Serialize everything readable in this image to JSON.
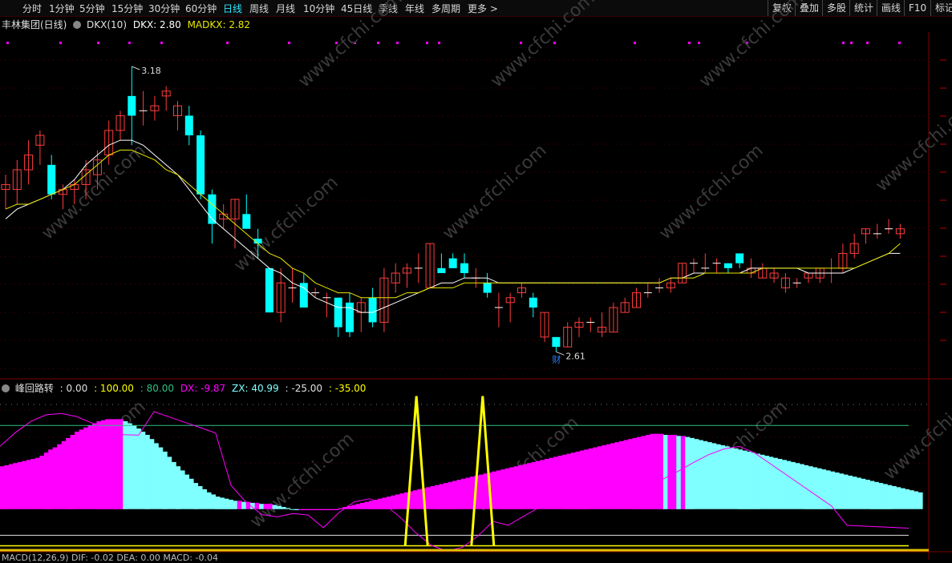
{
  "toolbar": {
    "tabs": [
      "分时",
      "1分钟",
      "5分钟",
      "15分钟",
      "30分钟",
      "60分钟",
      "日线",
      "周线",
      "月线",
      "10分钟",
      "45日线",
      "季线",
      "年线",
      "多周期",
      "更多 >"
    ],
    "active_tab": "日线",
    "right_tabs": [
      "复权",
      "叠加",
      "多股",
      "统计",
      "画线",
      "F10",
      "标记"
    ]
  },
  "main_legend": {
    "stock": "丰林集团(日线)",
    "indicator": "DKX(10)",
    "dkx": "DKX: 2.80",
    "madkx": "MADKX: 2.82"
  },
  "sub_legend": {
    "name": "峰回路转",
    "values": [
      ": 0.00",
      ": 100.00",
      ": 80.00",
      "DX: -9.87",
      "ZX: 40.99",
      ": -25.00",
      ": -35.00"
    ]
  },
  "macd_legend": {
    "text": "MACD(12,26,9)  DIF: -0.02  DEA: 0.00  MACD: -0.04"
  },
  "annotations": {
    "high": "3.18",
    "low": "2.61",
    "marker": "财"
  },
  "watermark": "www.cfchi.com",
  "colors": {
    "up": "#ff3c3c",
    "down": "#00ffff",
    "dkx": "#ffffff",
    "madkx": "#e8e800",
    "magenta": "#ff00ff",
    "cyan_bar": "#7fffff",
    "yellow": "#ffff00",
    "green_line": "#2fbf7f"
  },
  "chart_data": [
    {
      "type": "candlestick",
      "title": "丰林集团(日线)",
      "ylim": [
        2.55,
        3.25
      ],
      "candles": [
        {
          "o": 2.93,
          "h": 2.96,
          "l": 2.89,
          "c": 2.94
        },
        {
          "o": 2.93,
          "h": 2.99,
          "l": 2.9,
          "c": 2.97
        },
        {
          "o": 2.97,
          "h": 3.03,
          "l": 2.94,
          "c": 3.0
        },
        {
          "o": 3.02,
          "h": 3.05,
          "l": 2.98,
          "c": 3.04
        },
        {
          "o": 2.98,
          "h": 3.0,
          "l": 2.91,
          "c": 2.92
        },
        {
          "o": 2.92,
          "h": 2.94,
          "l": 2.89,
          "c": 2.93
        },
        {
          "o": 2.93,
          "h": 2.95,
          "l": 2.9,
          "c": 2.94
        },
        {
          "o": 2.94,
          "h": 2.99,
          "l": 2.91,
          "c": 2.97
        },
        {
          "o": 2.96,
          "h": 3.01,
          "l": 2.93,
          "c": 2.99
        },
        {
          "o": 3.0,
          "h": 3.07,
          "l": 2.98,
          "c": 3.05
        },
        {
          "o": 3.05,
          "h": 3.09,
          "l": 3.03,
          "c": 3.08
        },
        {
          "o": 3.12,
          "h": 3.18,
          "l": 3.02,
          "c": 3.08
        },
        {
          "o": 3.09,
          "h": 3.13,
          "l": 3.06,
          "c": 3.09
        },
        {
          "o": 3.09,
          "h": 3.12,
          "l": 3.07,
          "c": 3.1
        },
        {
          "o": 3.12,
          "h": 3.14,
          "l": 3.09,
          "c": 3.13
        },
        {
          "o": 3.08,
          "h": 3.11,
          "l": 3.05,
          "c": 3.1
        },
        {
          "o": 3.08,
          "h": 3.1,
          "l": 3.02,
          "c": 3.04
        },
        {
          "o": 3.04,
          "h": 3.05,
          "l": 2.91,
          "c": 2.92
        },
        {
          "o": 2.92,
          "h": 2.93,
          "l": 2.82,
          "c": 2.86
        },
        {
          "o": 2.87,
          "h": 2.9,
          "l": 2.85,
          "c": 2.88
        },
        {
          "o": 2.87,
          "h": 2.91,
          "l": 2.81,
          "c": 2.91
        },
        {
          "o": 2.88,
          "h": 2.92,
          "l": 2.85,
          "c": 2.85
        },
        {
          "o": 2.83,
          "h": 2.85,
          "l": 2.79,
          "c": 2.82
        },
        {
          "o": 2.77,
          "h": 2.77,
          "l": 2.68,
          "c": 2.68
        },
        {
          "o": 2.68,
          "h": 2.77,
          "l": 2.66,
          "c": 2.74
        },
        {
          "o": 2.73,
          "h": 2.77,
          "l": 2.7,
          "c": 2.73
        },
        {
          "o": 2.74,
          "h": 2.76,
          "l": 2.69,
          "c": 2.69
        },
        {
          "o": 2.72,
          "h": 2.73,
          "l": 2.71,
          "c": 2.72
        },
        {
          "o": 2.71,
          "h": 2.72,
          "l": 2.67,
          "c": 2.71
        },
        {
          "o": 2.71,
          "h": 2.71,
          "l": 2.63,
          "c": 2.65
        },
        {
          "o": 2.7,
          "h": 2.72,
          "l": 2.63,
          "c": 2.64
        },
        {
          "o": 2.68,
          "h": 2.71,
          "l": 2.64,
          "c": 2.7
        },
        {
          "o": 2.71,
          "h": 2.73,
          "l": 2.65,
          "c": 2.66
        },
        {
          "o": 2.66,
          "h": 2.77,
          "l": 2.64,
          "c": 2.75
        },
        {
          "o": 2.74,
          "h": 2.78,
          "l": 2.72,
          "c": 2.76
        },
        {
          "o": 2.76,
          "h": 2.78,
          "l": 2.73,
          "c": 2.77
        },
        {
          "o": 2.77,
          "h": 2.8,
          "l": 2.74,
          "c": 2.77
        },
        {
          "o": 2.73,
          "h": 2.82,
          "l": 2.73,
          "c": 2.82
        },
        {
          "o": 2.77,
          "h": 2.8,
          "l": 2.76,
          "c": 2.76
        },
        {
          "o": 2.79,
          "h": 2.8,
          "l": 2.77,
          "c": 2.77
        },
        {
          "o": 2.78,
          "h": 2.8,
          "l": 2.75,
          "c": 2.76
        },
        {
          "o": 2.75,
          "h": 2.77,
          "l": 2.73,
          "c": 2.75
        },
        {
          "o": 2.74,
          "h": 2.76,
          "l": 2.71,
          "c": 2.72
        },
        {
          "o": 2.69,
          "h": 2.72,
          "l": 2.65,
          "c": 2.69
        },
        {
          "o": 2.7,
          "h": 2.72,
          "l": 2.66,
          "c": 2.71
        },
        {
          "o": 2.72,
          "h": 2.74,
          "l": 2.71,
          "c": 2.73
        },
        {
          "o": 2.71,
          "h": 2.72,
          "l": 2.67,
          "c": 2.69
        },
        {
          "o": 2.63,
          "h": 2.68,
          "l": 2.62,
          "c": 2.68
        },
        {
          "o": 2.63,
          "h": 2.63,
          "l": 2.6,
          "c": 2.61
        },
        {
          "o": 2.61,
          "h": 2.66,
          "l": 2.61,
          "c": 2.65
        },
        {
          "o": 2.65,
          "h": 2.67,
          "l": 2.63,
          "c": 2.66
        },
        {
          "o": 2.66,
          "h": 2.67,
          "l": 2.64,
          "c": 2.66
        },
        {
          "o": 2.64,
          "h": 2.68,
          "l": 2.63,
          "c": 2.65
        },
        {
          "o": 2.64,
          "h": 2.7,
          "l": 2.64,
          "c": 2.69
        },
        {
          "o": 2.68,
          "h": 2.71,
          "l": 2.68,
          "c": 2.7
        },
        {
          "o": 2.69,
          "h": 2.73,
          "l": 2.69,
          "c": 2.72
        },
        {
          "o": 2.72,
          "h": 2.74,
          "l": 2.71,
          "c": 2.72
        },
        {
          "o": 2.73,
          "h": 2.75,
          "l": 2.72,
          "c": 2.73
        },
        {
          "o": 2.73,
          "h": 2.75,
          "l": 2.72,
          "c": 2.74
        },
        {
          "o": 2.74,
          "h": 2.78,
          "l": 2.74,
          "c": 2.78
        },
        {
          "o": 2.78,
          "h": 2.79,
          "l": 2.76,
          "c": 2.78
        },
        {
          "o": 2.77,
          "h": 2.8,
          "l": 2.76,
          "c": 2.77
        },
        {
          "o": 2.78,
          "h": 2.79,
          "l": 2.76,
          "c": 2.78
        },
        {
          "o": 2.78,
          "h": 2.78,
          "l": 2.76,
          "c": 2.77
        },
        {
          "o": 2.8,
          "h": 2.8,
          "l": 2.77,
          "c": 2.78
        },
        {
          "o": 2.76,
          "h": 2.79,
          "l": 2.75,
          "c": 2.77
        },
        {
          "o": 2.75,
          "h": 2.78,
          "l": 2.75,
          "c": 2.77
        },
        {
          "o": 2.75,
          "h": 2.77,
          "l": 2.74,
          "c": 2.76
        },
        {
          "o": 2.73,
          "h": 2.76,
          "l": 2.72,
          "c": 2.75
        },
        {
          "o": 2.74,
          "h": 2.75,
          "l": 2.73,
          "c": 2.74
        },
        {
          "o": 2.75,
          "h": 2.76,
          "l": 2.74,
          "c": 2.76
        },
        {
          "o": 2.75,
          "h": 2.77,
          "l": 2.74,
          "c": 2.77
        },
        {
          "o": 2.76,
          "h": 2.79,
          "l": 2.74,
          "c": 2.76
        },
        {
          "o": 2.77,
          "h": 2.82,
          "l": 2.76,
          "c": 2.8
        },
        {
          "o": 2.8,
          "h": 2.84,
          "l": 2.79,
          "c": 2.82
        },
        {
          "o": 2.84,
          "h": 2.85,
          "l": 2.82,
          "c": 2.85
        },
        {
          "o": 2.84,
          "h": 2.86,
          "l": 2.83,
          "c": 2.84
        },
        {
          "o": 2.85,
          "h": 2.87,
          "l": 2.84,
          "c": 2.85
        },
        {
          "o": 2.84,
          "h": 2.86,
          "l": 2.83,
          "c": 2.85
        }
      ],
      "dkx": [
        2.87,
        2.89,
        2.9,
        2.91,
        2.92,
        2.93,
        2.95,
        2.98,
        3.0,
        3.02,
        3.03,
        3.03,
        3.02,
        3.0,
        2.98,
        2.96,
        2.93,
        2.9,
        2.87,
        2.85,
        2.83,
        2.81,
        2.79,
        2.77,
        2.76,
        2.74,
        2.73,
        2.71,
        2.7,
        2.69,
        2.69,
        2.68,
        2.68,
        2.69,
        2.7,
        2.71,
        2.72,
        2.73,
        2.74,
        2.74,
        2.75,
        2.75,
        2.75,
        2.74,
        2.74,
        2.74,
        2.74,
        2.74,
        2.74,
        2.74,
        2.74,
        2.74,
        2.74,
        2.74,
        2.74,
        2.74,
        2.74,
        2.74,
        2.75,
        2.75,
        2.76,
        2.76,
        2.76,
        2.76,
        2.76,
        2.77,
        2.77,
        2.77,
        2.77,
        2.77,
        2.76,
        2.76,
        2.76,
        2.76,
        2.77,
        2.78,
        2.79,
        2.8,
        2.8
      ],
      "madkx": [
        2.89,
        2.9,
        2.9,
        2.91,
        2.92,
        2.93,
        2.94,
        2.96,
        2.98,
        3.0,
        3.01,
        3.01,
        3.0,
        2.99,
        2.97,
        2.96,
        2.94,
        2.92,
        2.9,
        2.88,
        2.86,
        2.84,
        2.82,
        2.8,
        2.79,
        2.77,
        2.76,
        2.74,
        2.73,
        2.72,
        2.72,
        2.71,
        2.71,
        2.71,
        2.71,
        2.72,
        2.72,
        2.73,
        2.73,
        2.73,
        2.74,
        2.74,
        2.74,
        2.74,
        2.74,
        2.74,
        2.74,
        2.74,
        2.74,
        2.74,
        2.74,
        2.74,
        2.74,
        2.74,
        2.74,
        2.74,
        2.74,
        2.74,
        2.75,
        2.75,
        2.75,
        2.76,
        2.76,
        2.76,
        2.76,
        2.76,
        2.77,
        2.77,
        2.77,
        2.77,
        2.77,
        2.77,
        2.77,
        2.77,
        2.77,
        2.78,
        2.79,
        2.8,
        2.82
      ]
    },
    {
      "type": "bar",
      "title": "峰回路转",
      "ylim": [
        -40,
        110
      ],
      "reference_lines": [
        100,
        80,
        0,
        -25,
        -35
      ],
      "series": [
        {
          "name": "DX",
          "values": [
            -9.87
          ]
        },
        {
          "name": "ZX",
          "values": [
            40.99
          ]
        }
      ],
      "bars": [
        41,
        42,
        43,
        44,
        45,
        46,
        47,
        48,
        49,
        51,
        54,
        57,
        59,
        62,
        65,
        68,
        71,
        74,
        76,
        78,
        80,
        82,
        84,
        85,
        86,
        86,
        86,
        86,
        84,
        82,
        80,
        77,
        74,
        71,
        67,
        63,
        59,
        55,
        50,
        45,
        41,
        37,
        33,
        29,
        25,
        22,
        19,
        16,
        14,
        12,
        11,
        10,
        9,
        8,
        8,
        7,
        7,
        6,
        6,
        5,
        5,
        5,
        4,
        3,
        2,
        1,
        0,
        -1,
        -1,
        -1,
        -1,
        -1,
        -1,
        -1,
        -1,
        -1,
        -1,
        1,
        2,
        3,
        4,
        5,
        6,
        7,
        8,
        9,
        10,
        11,
        12,
        13,
        14,
        15,
        16,
        17,
        18,
        19,
        20,
        21,
        22,
        23,
        24,
        25,
        26,
        27,
        28,
        29,
        30,
        31,
        32,
        33,
        34,
        35,
        36,
        37,
        38,
        39,
        40,
        41,
        42,
        43,
        44,
        45,
        46,
        47,
        48,
        49,
        50,
        51,
        52,
        53,
        54,
        55,
        56,
        57,
        58,
        59,
        60,
        61,
        62,
        63,
        64,
        65,
        66,
        67,
        68,
        69,
        70,
        71,
        72,
        72,
        72,
        71,
        71,
        71,
        70,
        70,
        69,
        68,
        67,
        66,
        65,
        64,
        63,
        62,
        61,
        60,
        59,
        58,
        57,
        56,
        55,
        54,
        53,
        52,
        51,
        50,
        49,
        48,
        47,
        46,
        45,
        44,
        43,
        42,
        41,
        40,
        39,
        38,
        37,
        36,
        35,
        34,
        33,
        32,
        31,
        30,
        29,
        28,
        27,
        26,
        25,
        24,
        23,
        22,
        21,
        20,
        19,
        18,
        17,
        16
      ],
      "spikes_at_fraction": [
        0.44,
        0.51
      ]
    }
  ]
}
